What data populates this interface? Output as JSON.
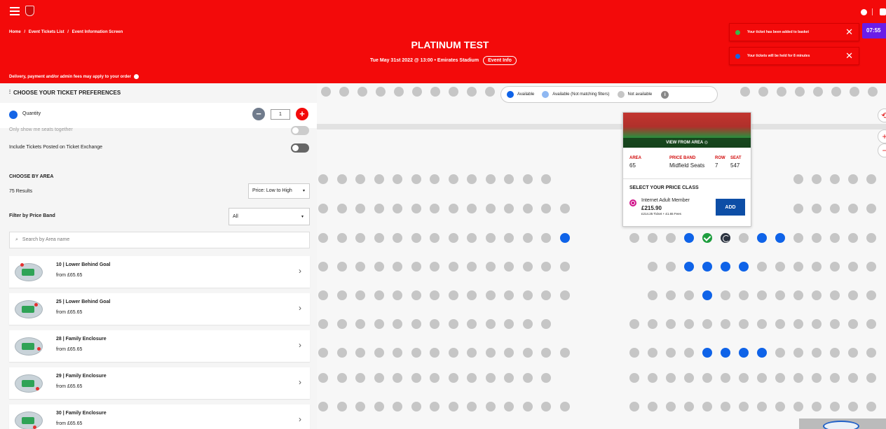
{
  "header": {
    "breadcrumb": [
      "Home",
      "/",
      "Event Tickets List",
      "/",
      "Event Information Screen"
    ],
    "fees_note": "Delivery, payment and/or admin fees may apply to your order",
    "event_title": "PLATINUM TEST",
    "event_date": "Tue May 31st 2022 @ 13:00 • Emirates Stadium",
    "event_info_label": "Event Info",
    "timer": "07:55",
    "toasts": [
      {
        "msg": "Your ticket has been added to basket",
        "dot": "#3bb54a"
      },
      {
        "msg": "Your tickets will be held for 8 minutes",
        "dot": "#1464e6"
      }
    ]
  },
  "prefs": {
    "title": "CHOOSE YOUR TICKET PREFERENCES",
    "quantity_label": "Quantity",
    "quantity_value": "1",
    "seats_together": "Only show me seats together",
    "ticket_exchange": "Include Tickets Posted on Ticket Exchange"
  },
  "areas": {
    "title": "CHOOSE BY AREA",
    "results": "75 Results",
    "sort_value": "Price: Low to High",
    "filter_label": "Filter by Price Band",
    "band_value": "All",
    "search_placeholder": "Search by Area name",
    "items": [
      {
        "name": "10 | Lower Behind Goal",
        "price": "from £65.65"
      },
      {
        "name": "25 | Lower Behind Goal",
        "price": "from £65.65"
      },
      {
        "name": "28 | Family Enclosure",
        "price": "from £65.65"
      },
      {
        "name": "29 | Family Enclosure",
        "price": "from £65.65"
      },
      {
        "name": "30 | Family Enclosure",
        "price": "from £65.65"
      }
    ]
  },
  "legend": {
    "available": "Available",
    "not_matching": "Available (Not matching filters)",
    "not_available": "Not available",
    "colors": {
      "available": "#0f63e8",
      "not_matching": "#8fb8f2",
      "not_available": "#c6c6c6"
    }
  },
  "popup": {
    "view_label": "VIEW FROM AREA",
    "area_label": "AREA",
    "area_value": "65",
    "band_label": "PRICE BAND",
    "band_value": "Midfield Seats",
    "row_label": "ROW",
    "row_value": "7",
    "seat_label": "SEAT",
    "seat_value": "547",
    "price_class_title": "SELECT YOUR PRICE CLASS",
    "class_name": "Internet Adult Member",
    "class_price": "£215.90",
    "class_breakdown": "£214.25 Ticket + £1.65 Fees",
    "add_label": "ADD"
  }
}
